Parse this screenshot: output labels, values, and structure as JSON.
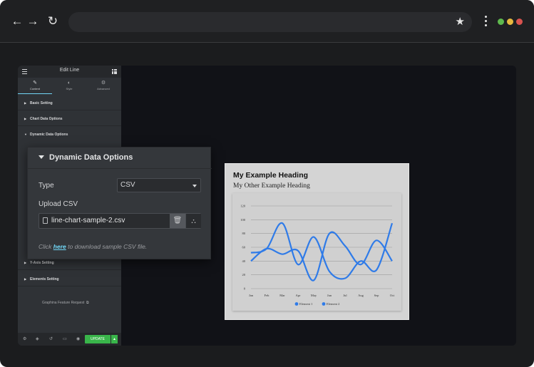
{
  "browser": {
    "address": "",
    "icons": [
      "back-arrow-icon",
      "forward-arrow-icon",
      "reload-icon",
      "star-icon",
      "more-icon"
    ],
    "window_dots": [
      "#5fb94e",
      "#e7b93f",
      "#d9534f"
    ]
  },
  "panel": {
    "title": "Edit Line",
    "tabs": [
      {
        "label": "Content",
        "icon": "pencil-icon"
      },
      {
        "label": "Style",
        "icon": "contrast-icon"
      },
      {
        "label": "Advanced",
        "icon": "gear-icon"
      }
    ],
    "sections": [
      "Basic Setting",
      "Chart Data Options",
      "Dynamic Data Options",
      "Y-Axis Setting",
      "Elements Setting"
    ],
    "feature_request": "Graphina Feature Request",
    "update_label": "UPDATE"
  },
  "popover": {
    "title": "Dynamic Data Options",
    "type_label": "Type",
    "type_value": "CSV",
    "upload_label": "Upload CSV",
    "file_name": "line-chart-sample-2.csv",
    "note_prefix": "Click",
    "note_link": "here",
    "note_suffix": "to download sample CSV file."
  },
  "chart": {
    "heading": "My Example Heading",
    "subheading": "My Other Example Heading"
  },
  "chart_data": {
    "type": "line",
    "title": "",
    "categories": [
      "Jan",
      "Feb",
      "Mar",
      "Apr",
      "May",
      "Jun",
      "Jul",
      "Aug",
      "Sep",
      "Oct"
    ],
    "series": [
      {
        "name": "Element 1",
        "values": [
          40,
          58,
          50,
          55,
          12,
          80,
          62,
          35,
          70,
          40
        ],
        "color": "#2f7be8"
      },
      {
        "name": "Element 2",
        "values": [
          52,
          58,
          95,
          35,
          75,
          25,
          15,
          40,
          27,
          95
        ],
        "color": "#2f7be8"
      }
    ],
    "ylim": [
      0,
      120
    ],
    "yticks": [
      0,
      20,
      40,
      60,
      80,
      100,
      120
    ],
    "grid": true,
    "legend": "bottom"
  }
}
